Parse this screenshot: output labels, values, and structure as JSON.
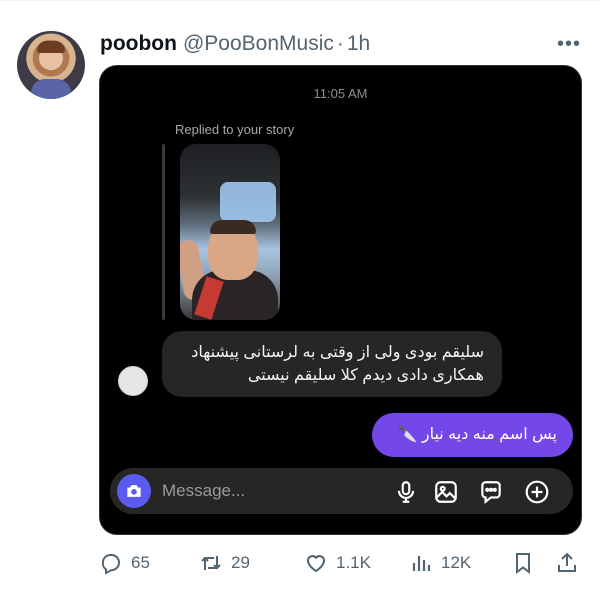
{
  "tweet": {
    "display_name": "poobon",
    "handle": "@PooBonMusic",
    "separator": "·",
    "time": "1h",
    "more_icon": "more-horizontal-icon"
  },
  "dm": {
    "timestamp": "11:05 AM",
    "replied_label": "Replied to your story",
    "incoming_message": "سلیقم بودی ولی از وقتی به لرستانی پیشنهاد همکاری دادی دیدم کلا سلیقم نیستی",
    "outgoing_message": "پس اسم منه دیه نیار 🔪",
    "composer": {
      "placeholder": "Message...",
      "icons": [
        "camera-icon",
        "microphone-icon",
        "gallery-icon",
        "sticker-icon",
        "plus-icon"
      ]
    },
    "colors": {
      "background": "#000000",
      "incoming_bubble": "#262626",
      "outgoing_bubble": "#7448e8",
      "camera_button": "#5b5bf0"
    }
  },
  "actions": {
    "replies": "65",
    "reposts": "29",
    "likes": "1.1K",
    "views": "12K",
    "icons": [
      "reply-icon",
      "repost-icon",
      "like-icon",
      "views-icon",
      "bookmark-icon",
      "share-icon"
    ]
  }
}
